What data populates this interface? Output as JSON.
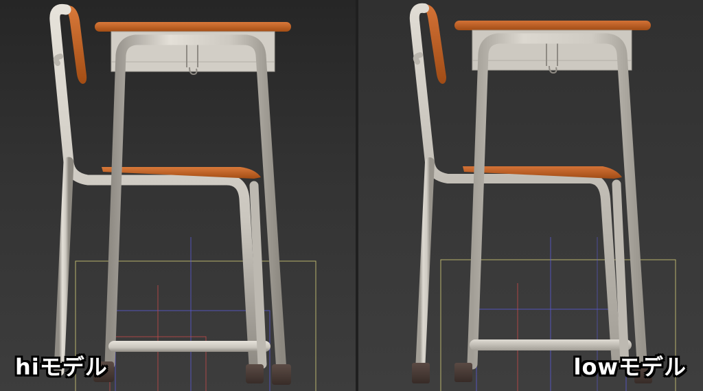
{
  "viewports": {
    "left": {
      "label": "hiモデル"
    },
    "right": {
      "label": "lowモデル"
    }
  },
  "colors": {
    "background_left": "#2f2f2f",
    "background_right": "#383838",
    "metal": "#d8d4cc",
    "metal_shadow": "#9d9990",
    "wood": "#c8651f",
    "wood_dark": "#8a3f10",
    "foot_cap": "#4a3d38",
    "gizmo_yellow": "#d8d27a",
    "gizmo_blue": "#5a5ad8",
    "gizmo_red": "#c84a4a"
  }
}
